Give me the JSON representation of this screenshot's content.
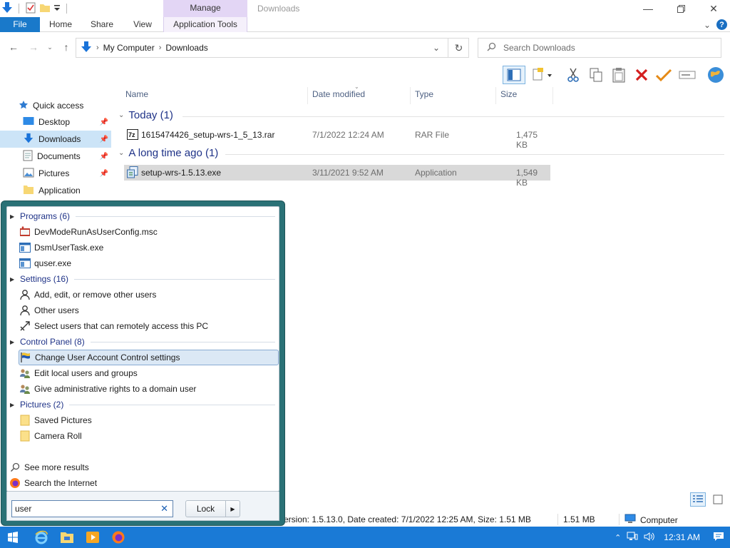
{
  "window": {
    "title": "Downloads",
    "context_tab": "Manage"
  },
  "ribbon": {
    "tabs": [
      "File",
      "Home",
      "Share",
      "View",
      "Application Tools"
    ]
  },
  "address": {
    "crumbs": [
      "My Computer",
      "Downloads"
    ],
    "search_placeholder": "Search Downloads"
  },
  "nav": {
    "quick_access": "Quick access",
    "items": [
      {
        "label": "Desktop",
        "icon": "desktop-icon",
        "pinned": true
      },
      {
        "label": "Downloads",
        "icon": "downloads-icon",
        "pinned": true,
        "selected": true
      },
      {
        "label": "Documents",
        "icon": "documents-icon",
        "pinned": true
      },
      {
        "label": "Pictures",
        "icon": "pictures-icon",
        "pinned": true
      },
      {
        "label": "Application",
        "icon": "folder-icon",
        "pinned": false
      }
    ]
  },
  "files": {
    "columns": [
      "Name",
      "Date modified",
      "Type",
      "Size"
    ],
    "groups": [
      {
        "label": "Today (1)",
        "rows": [
          {
            "name": "1615474426_setup-wrs-1_5_13.rar",
            "date": "7/1/2022 12:24 AM",
            "type": "RAR File",
            "size": "1,475 KB"
          }
        ]
      },
      {
        "label": "A long time ago (1)",
        "rows": [
          {
            "name": "setup-wrs-1.5.13.exe",
            "date": "3/11/2021 9:52 AM",
            "type": "Application",
            "size": "1,549 KB"
          }
        ]
      }
    ]
  },
  "status": {
    "details": "ersion: 1.5.13.0, Date created: 7/1/2022 12:25 AM, Size: 1.51 MB",
    "size": "1.51 MB",
    "location": "Computer"
  },
  "start_menu": {
    "sections": [
      {
        "header": "Programs (6)",
        "items": [
          "DevModeRunAsUserConfig.msc",
          "DsmUserTask.exe",
          "quser.exe"
        ]
      },
      {
        "header": "Settings (16)",
        "items": [
          "Add, edit, or remove other users",
          "Other users",
          "Select users that can remotely access this PC"
        ]
      },
      {
        "header": "Control Panel (8)",
        "items": [
          "Change User Account Control settings",
          "Edit local users and groups",
          "Give administrative rights to a domain user"
        ]
      },
      {
        "header": "Pictures (2)",
        "items": [
          "Saved Pictures",
          "Camera Roll"
        ]
      }
    ],
    "see_more": "See more results",
    "search_internet": "Search the Internet",
    "search_value": "user",
    "lock_label": "Lock"
  },
  "taskbar": {
    "clock": "12:31 AM"
  },
  "colors": {
    "accent": "#1979ca",
    "taskbar": "#1a7ad6",
    "start_frame": "#2a7176",
    "group_text": "#1e3287",
    "manage_tab": "#e3d6f5"
  }
}
